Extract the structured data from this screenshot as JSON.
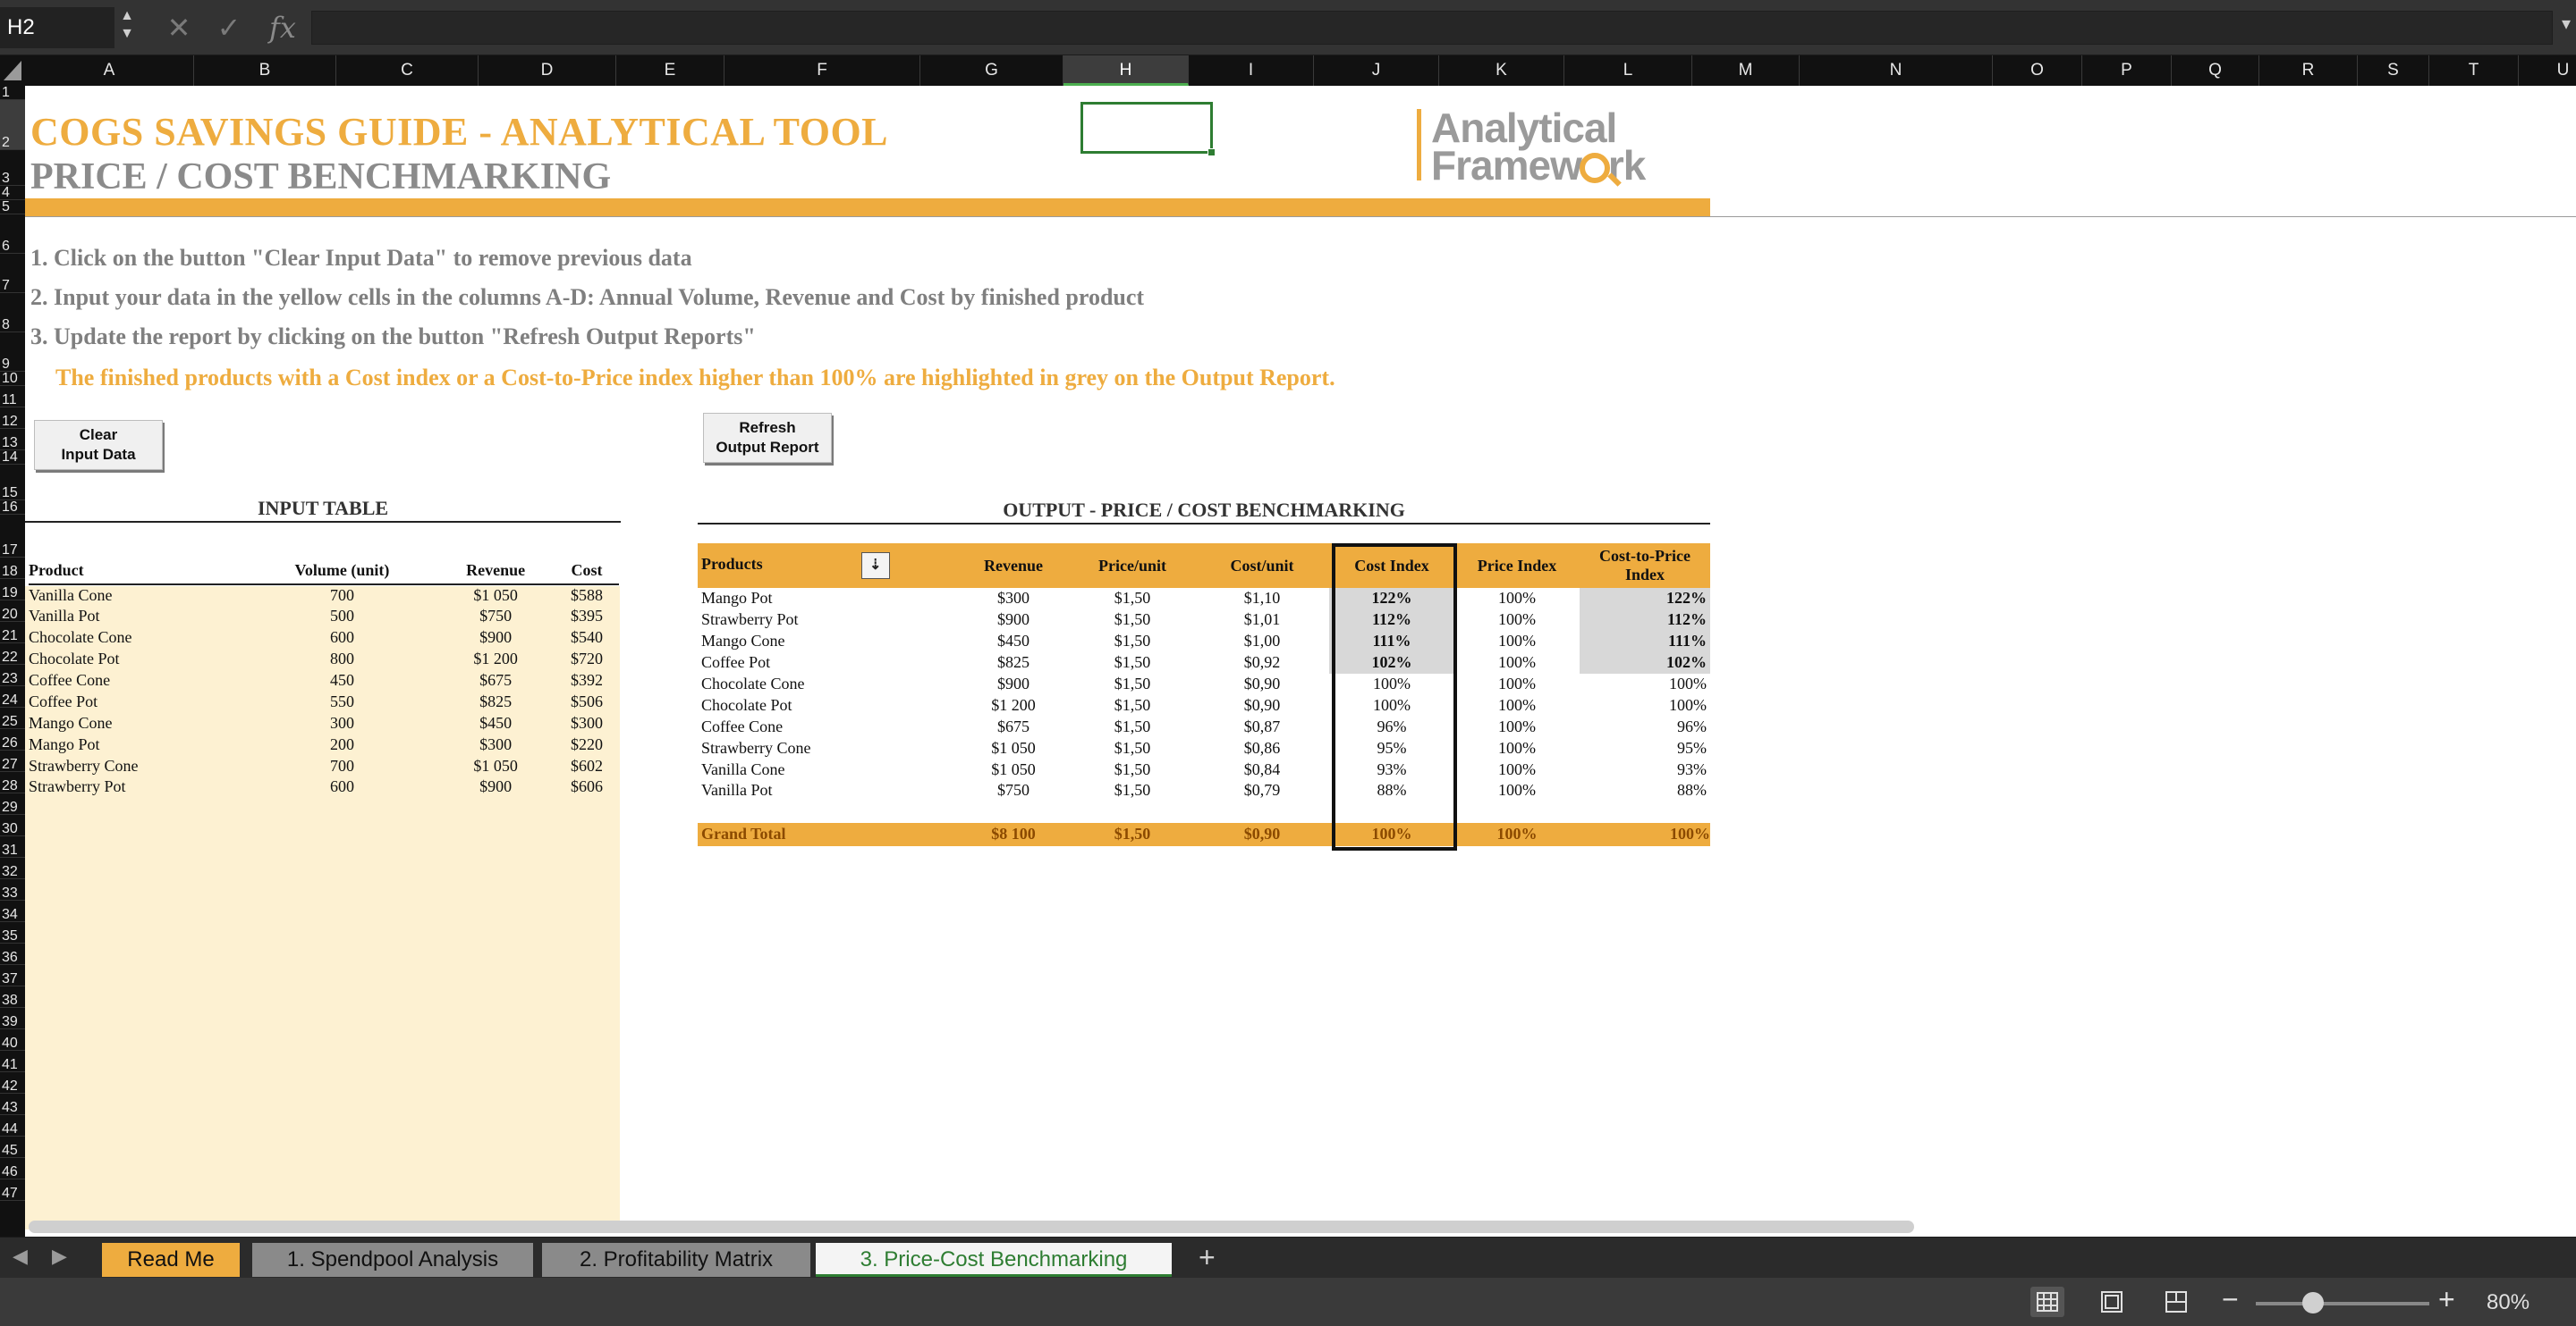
{
  "formula_bar": {
    "name_box": "H2",
    "stepper_glyph": "▲▼",
    "cancel_glyph": "✕",
    "confirm_glyph": "✓",
    "fx_label": "fx",
    "formula_value": "",
    "expand_glyph": "▾"
  },
  "columns": [
    "A",
    "B",
    "C",
    "D",
    "E",
    "F",
    "G",
    "H",
    "I",
    "J",
    "K",
    "L",
    "M",
    "N",
    "O",
    "P",
    "Q",
    "R",
    "S",
    "T",
    "U"
  ],
  "rows": [
    "1",
    "2",
    "3",
    "4",
    "5",
    "6",
    "7",
    "8",
    "9",
    "10",
    "11",
    "12",
    "13",
    "14",
    "15",
    "16",
    "17",
    "18",
    "19",
    "20",
    "21",
    "22",
    "23",
    "24",
    "25",
    "26",
    "27",
    "28",
    "29",
    "30",
    "31",
    "32",
    "33",
    "34",
    "35",
    "36",
    "37",
    "38",
    "39",
    "40",
    "41",
    "42",
    "43",
    "44",
    "45",
    "46",
    "47"
  ],
  "selected": {
    "column": "H",
    "row": "2"
  },
  "header": {
    "title": "COGS SAVINGS GUIDE - ANALYTICAL TOOL",
    "subtitle": "PRICE / COST BENCHMARKING",
    "logo_line1": "Analytical",
    "logo_line2_a": "Framew",
    "logo_line2_b": "rk"
  },
  "instructions": {
    "step1": "1. Click on the button \"Clear Input Data\" to remove previous data",
    "step2": "2. Input your data in the yellow cells in the columns A-D: Annual Volume, Revenue and Cost by finished product",
    "step3": "3. Update the report by clicking on the button \"Refresh Output Reports\"",
    "note": "The finished products with a Cost index or a Cost-to-Price index higher than 100% are highlighted in grey on the Output Report."
  },
  "buttons": {
    "clear_line1": "Clear",
    "clear_line2": "Input Data",
    "refresh_line1": "Refresh",
    "refresh_line2": "Output Report"
  },
  "input_table": {
    "title": "INPUT TABLE",
    "headers": [
      "Product",
      "Volume (unit)",
      "Revenue",
      "Cost"
    ],
    "rows": [
      [
        "Vanilla Cone",
        "700",
        "$1 050",
        "$588"
      ],
      [
        "Vanilla Pot",
        "500",
        "$750",
        "$395"
      ],
      [
        "Chocolate Cone",
        "600",
        "$900",
        "$540"
      ],
      [
        "Chocolate Pot",
        "800",
        "$1 200",
        "$720"
      ],
      [
        "Coffee Cone",
        "450",
        "$675",
        "$392"
      ],
      [
        "Coffee Pot",
        "550",
        "$825",
        "$506"
      ],
      [
        "Mango Cone",
        "300",
        "$450",
        "$300"
      ],
      [
        "Mango Pot",
        "200",
        "$300",
        "$220"
      ],
      [
        "Strawberry Cone",
        "700",
        "$1 050",
        "$602"
      ],
      [
        "Strawberry Pot",
        "600",
        "$900",
        "$606"
      ]
    ]
  },
  "output_table": {
    "title": "OUTPUT - PRICE / COST BENCHMARKING",
    "headers": [
      "Products",
      "Revenue",
      "Price/unit",
      "Cost/unit",
      "Cost Index",
      "Price Index",
      "Cost-to-Price Index"
    ],
    "filter_glyph": "⇣",
    "rows": [
      {
        "cells": [
          "Mango Pot",
          "$300",
          "$1,50",
          "$1,10",
          "122%",
          "100%",
          "122%"
        ],
        "highlight": true
      },
      {
        "cells": [
          "Strawberry Pot",
          "$900",
          "$1,50",
          "$1,01",
          "112%",
          "100%",
          "112%"
        ],
        "highlight": true
      },
      {
        "cells": [
          "Mango Cone",
          "$450",
          "$1,50",
          "$1,00",
          "111%",
          "100%",
          "111%"
        ],
        "highlight": true
      },
      {
        "cells": [
          "Coffee Pot",
          "$825",
          "$1,50",
          "$0,92",
          "102%",
          "100%",
          "102%"
        ],
        "highlight": true
      },
      {
        "cells": [
          "Chocolate Cone",
          "$900",
          "$1,50",
          "$0,90",
          "100%",
          "100%",
          "100%"
        ],
        "highlight": false
      },
      {
        "cells": [
          "Chocolate Pot",
          "$1 200",
          "$1,50",
          "$0,90",
          "100%",
          "100%",
          "100%"
        ],
        "highlight": false
      },
      {
        "cells": [
          "Coffee Cone",
          "$675",
          "$1,50",
          "$0,87",
          "96%",
          "100%",
          "96%"
        ],
        "highlight": false
      },
      {
        "cells": [
          "Strawberry Cone",
          "$1 050",
          "$1,50",
          "$0,86",
          "95%",
          "100%",
          "95%"
        ],
        "highlight": false
      },
      {
        "cells": [
          "Vanilla Cone",
          "$1 050",
          "$1,50",
          "$0,84",
          "93%",
          "100%",
          "93%"
        ],
        "highlight": false
      },
      {
        "cells": [
          "Vanilla Pot",
          "$750",
          "$1,50",
          "$0,79",
          "88%",
          "100%",
          "88%"
        ],
        "highlight": false
      }
    ],
    "total": [
      "Grand Total",
      "$8 100",
      "$1,50",
      "$0,90",
      "100%",
      "100%",
      "100%"
    ]
  },
  "tabs": [
    {
      "label": "Read Me",
      "state": "orange"
    },
    {
      "label": "1. Spendpool Analysis",
      "state": "grey"
    },
    {
      "label": "2. Profitability Matrix",
      "state": "grey"
    },
    {
      "label": "3. Price-Cost Benchmarking",
      "state": "active"
    }
  ],
  "tab_nav": {
    "prev": "◀",
    "next": "▶",
    "add": "+"
  },
  "status_bar": {
    "zoom_minus": "−",
    "zoom_plus": "+",
    "zoom_level": "80%",
    "zoom_fraction": 0.33
  },
  "colors": {
    "accent_orange": "#eeac3f",
    "title_grey": "#8b8b8b",
    "input_yellow": "#fdf1d2",
    "highlight_grey": "#d8d8d8",
    "selection_green": "#2e7d32",
    "active_tab_text": "#2e7d32"
  }
}
